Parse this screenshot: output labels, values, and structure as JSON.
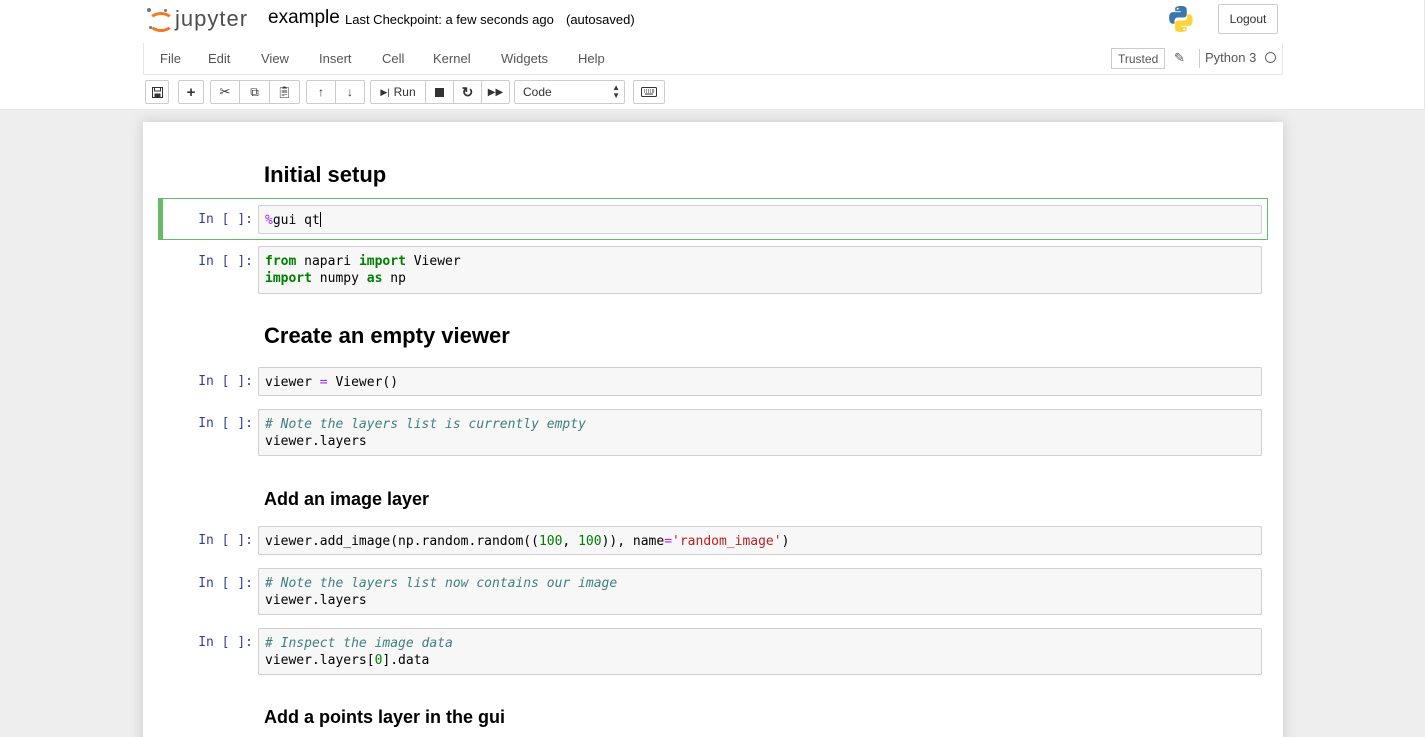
{
  "header": {
    "logo_text": "jupyter",
    "notebook_name": "example",
    "checkpoint": "Last Checkpoint: a few seconds ago",
    "autosave": "(autosaved)",
    "logout_label": "Logout"
  },
  "menubar": {
    "items": [
      "File",
      "Edit",
      "View",
      "Insert",
      "Cell",
      "Kernel",
      "Widgets",
      "Help"
    ],
    "trusted_label": "Trusted",
    "kernel_name": "Python 3"
  },
  "toolbar": {
    "run_label": "Run",
    "cell_type": "Code"
  },
  "cells": {
    "h_initial": "Initial setup",
    "h_create": "Create an empty viewer",
    "h_image": "Add an image layer",
    "h_points": "Add a points layer in the gui",
    "prompt": "In [ ]:",
    "c1": {
      "magic": "%",
      "rest": "gui qt"
    },
    "c2": {
      "l1_kw1": "from",
      "l1_mid": " napari ",
      "l1_kw2": "import",
      "l1_end": " Viewer",
      "l2_kw1": "import",
      "l2_mid": " numpy ",
      "l2_kw2": "as",
      "l2_end": " np"
    },
    "c3": {
      "a": "viewer ",
      "op": "=",
      "b": " Viewer()"
    },
    "c4": {
      "comment": "# Note the layers list is currently empty",
      "l2": "viewer.layers"
    },
    "c5": {
      "a": "viewer.add_image(np.random.random((",
      "n1": "100",
      "sep": ", ",
      "n2": "100",
      "b": ")), name",
      "op": "=",
      "s": "'random_image'",
      "c": ")"
    },
    "c6": {
      "comment": "# Note the layers list now contains our image",
      "l2": "viewer.layers"
    },
    "c7": {
      "comment": "# Inspect the image data",
      "a": "viewer.layers[",
      "n": "0",
      "b": "].data"
    }
  }
}
